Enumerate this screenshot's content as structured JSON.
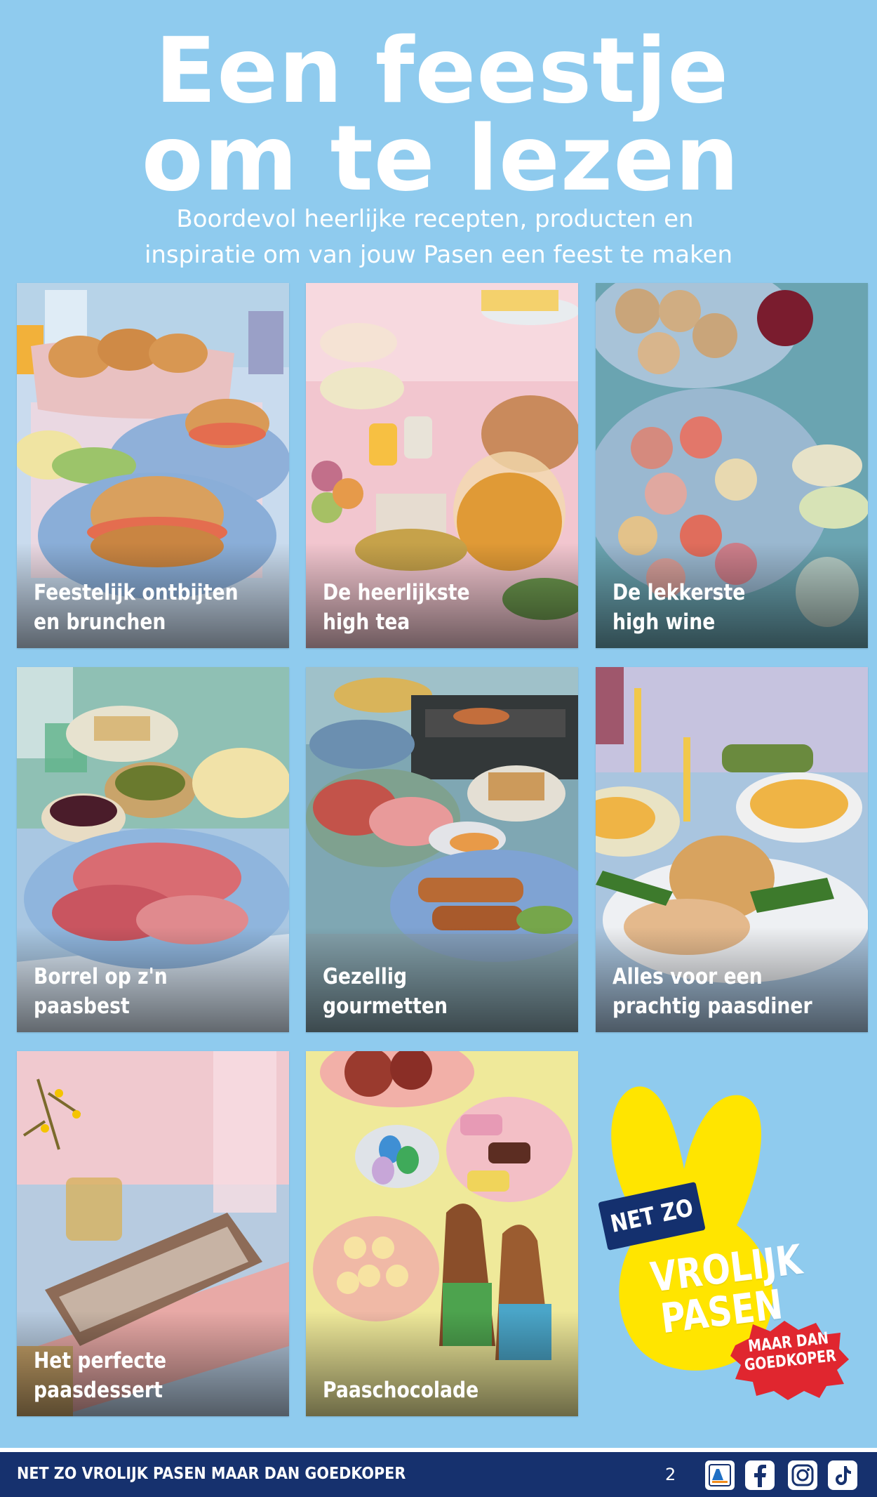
{
  "header": {
    "title_line1": "Een feestje",
    "title_line2": "om te lezen",
    "subtitle_line1": "Boordevol heerlijke recepten, producten en",
    "subtitle_line2": "inspiratie om van jouw Pasen een feest te maken"
  },
  "tiles": [
    {
      "line1": "Feestelijk ontbijten",
      "line2": "en brunchen",
      "photo": "bagels-breakfast-table"
    },
    {
      "line1": "De heerlijkste",
      "line2": "high tea",
      "photo": "high-tea-pastries-teapot"
    },
    {
      "line1": "De lekkerste",
      "line2": "high wine",
      "photo": "toast-bites-wraps-wine"
    },
    {
      "line1": "Borrel op z'n",
      "line2": "paasbest",
      "photo": "ham-olives-cheese-borrel"
    },
    {
      "line1": "Gezellig",
      "line2": "gourmetten",
      "photo": "gourmet-grill-meats"
    },
    {
      "line1": "Alles voor een",
      "line2": "prachtig paasdiner",
      "photo": "roast-green-beans-candles"
    },
    {
      "line1": "Het perfecte",
      "line2": "paasdessert",
      "photo": "cake-roll-dessert"
    },
    {
      "line1": "Paaschocolade",
      "line2": "",
      "photo": "chocolate-bunnies-eggs"
    }
  ],
  "promo": {
    "badge": "NET ZO",
    "main_line1": "VROLIJK",
    "main_line2": "PASEN",
    "burst_line1": "MAAR DAN",
    "burst_line2": "GOEDKOPER"
  },
  "footer": {
    "slogan": "NET ZO VROLIJK PASEN MAAR DAN GOEDKOPER",
    "page_number": "2",
    "icons": [
      "aldi-logo-icon",
      "facebook-icon",
      "instagram-icon",
      "tiktok-icon"
    ]
  },
  "colors": {
    "background": "#8fcbee",
    "footer": "#16316e",
    "bunny": "#ffe500",
    "burst": "#e0262f",
    "badge": "#14306e"
  }
}
